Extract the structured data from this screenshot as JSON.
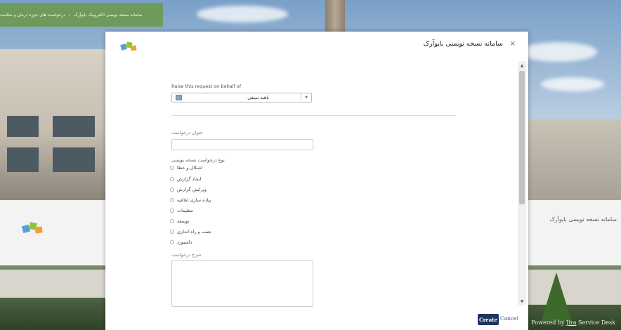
{
  "background": {
    "breadcrumb": [
      "سامانه نسخه نویسی الکترونیک بایوآرک",
      "›",
      "درخواست های حوزه درمان و سلامت"
    ],
    "portal_title": "سامانه نسخه نویسی بایوآرک",
    "powered_by_prefix": "Powered by",
    "powered_by_brand": "Jira",
    "powered_by_suffix": "Service Desk"
  },
  "modal": {
    "title": "سامانه نسخه نویسی بایوآرک",
    "close_symbol": "×",
    "on_behalf_label": "Raise this request on behalf of",
    "on_behalf_value": "ناهید سیفی",
    "summary_label": "عنوان درخواست",
    "summary_value": "",
    "request_type_label": "نوع درخواست نسخه نویسی",
    "request_type_options": [
      "اشکال و خطا",
      "ایجاد گزارش",
      "ویرایش گزارش",
      "پیاده سازی ابلاغیه",
      "تنظیمات",
      "توسعه",
      "نصب و راه اندازی",
      "داشبورد"
    ],
    "description_label": "شرح درخواست",
    "description_value": "",
    "create_label": "Create",
    "cancel_label": "Cancel"
  },
  "colors": {
    "accent": "#1e3560",
    "breadcrumb_bg": "#6e9a5c",
    "link": "#3b5a8a"
  }
}
